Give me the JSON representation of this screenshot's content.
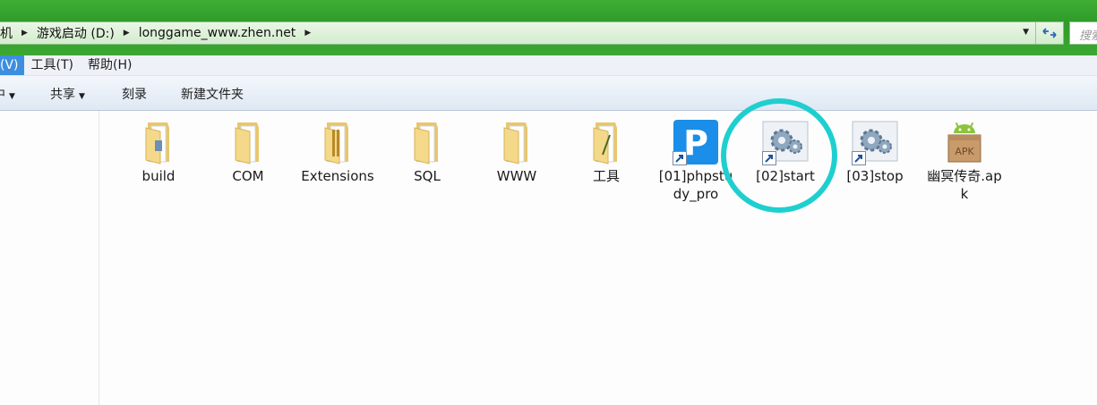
{
  "address": {
    "crumbs": [
      "机",
      "游戏启动 (D:)",
      "longgame_www.zhen.net"
    ]
  },
  "search": {
    "placeholder": "搜索"
  },
  "menu": [
    "(V)",
    "工具(T)",
    "帮助(H)"
  ],
  "toolbar": {
    "cut_label": "中",
    "share_label": "共享",
    "burn_label": "刻录",
    "new_folder_label": "新建文件夹"
  },
  "files": [
    {
      "label": "build",
      "icon": "folder-icon"
    },
    {
      "label": "COM",
      "icon": "folder-icon"
    },
    {
      "label": "Extensions",
      "icon": "folder-icon"
    },
    {
      "label": "SQL",
      "icon": "folder-icon"
    },
    {
      "label": "WWW",
      "icon": "folder-icon"
    },
    {
      "label": "工具",
      "icon": "folder-icon"
    },
    {
      "label": "[01]phpstudy_pro",
      "icon": "phpstudy-shortcut-icon"
    },
    {
      "label": "[02]start",
      "icon": "gear-shortcut-icon"
    },
    {
      "label": "[03]stop",
      "icon": "gear-shortcut-icon"
    },
    {
      "label": "幽冥传奇.apk",
      "icon": "apk-icon"
    }
  ],
  "colors": {
    "title_green": "#3aa832",
    "highlight": "#1fcfcf",
    "menu_active": "#3e8ee0"
  }
}
